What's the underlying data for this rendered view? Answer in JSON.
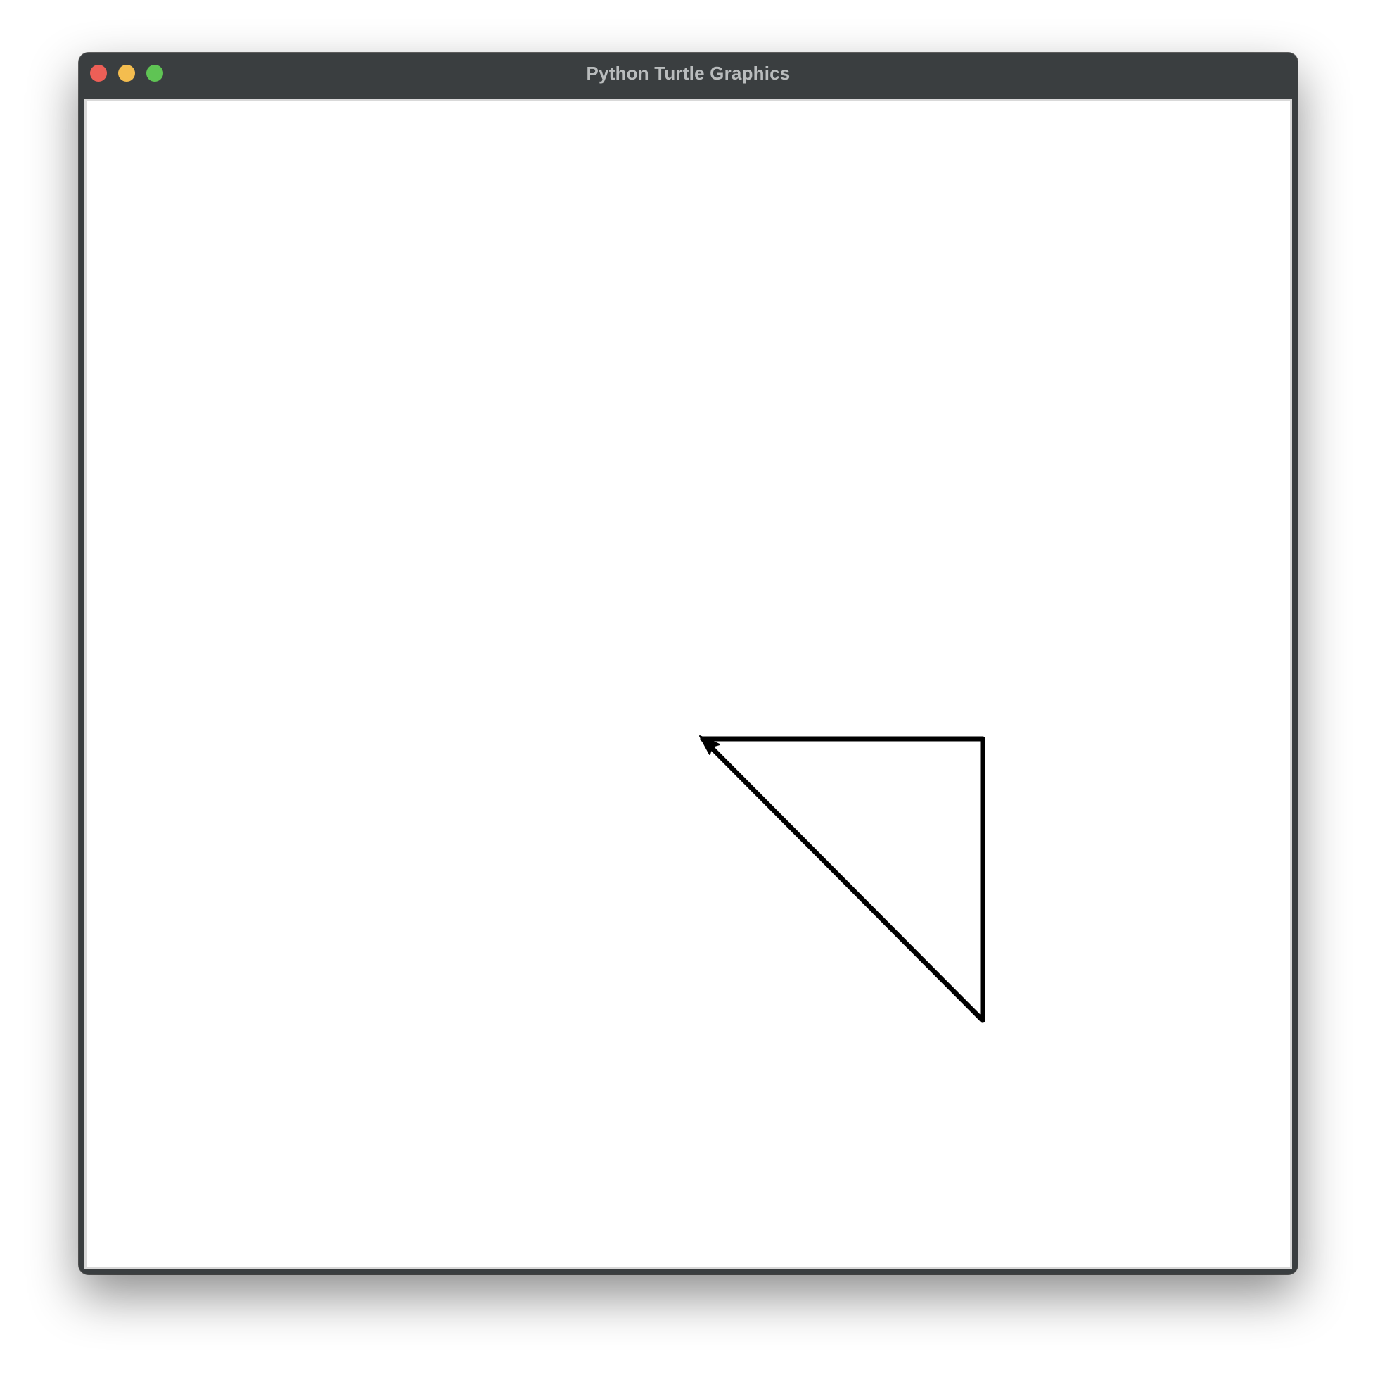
{
  "window": {
    "title": "Python Turtle Graphics"
  },
  "colors": {
    "titlebar": "#3a3e40",
    "close": "#ed5f57",
    "minimize": "#f4bd4f",
    "zoom": "#5fc454",
    "canvas": "#ffffff",
    "pen": "#000000"
  },
  "icons": {
    "close": "close-traffic-light-icon",
    "minimize": "minimize-traffic-light-icon",
    "zoom": "zoom-traffic-light-icon",
    "turtle": "turtle-arrow-cursor-icon"
  }
}
